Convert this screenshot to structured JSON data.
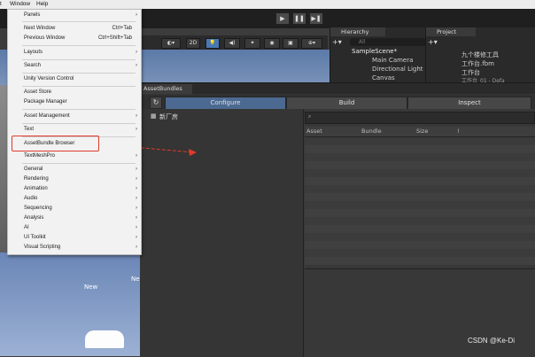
{
  "menubar": {
    "items": [
      "t",
      "Window",
      "Help"
    ]
  },
  "toolbar": {
    "play": "▶",
    "pause": "❚❚",
    "step": "▶❚"
  },
  "scenebar": {
    "mode_2d": "2D"
  },
  "hierarchy": {
    "title": "Hierarchy",
    "search_placeholder": "All",
    "rows": [
      "SampleScene*",
      "Main Camera",
      "Directional Light",
      "Canvas"
    ]
  },
  "project": {
    "title": "Project",
    "rows": [
      "九个楼修工具",
      "工作台.fbm",
      "工作台",
      "工作台_01 - Defa"
    ]
  },
  "asset_bundles": {
    "window_title": "AssetBundles",
    "tabs": [
      "Configure",
      "Build",
      "Inspect"
    ],
    "bundle_item": "新厂房",
    "columns": [
      "Asset",
      "Bundle",
      "Size",
      "!"
    ]
  },
  "menu": {
    "items": [
      {
        "label": "Panels"
      },
      {
        "label": "Next Window",
        "shortcut": "Ctrl+Tab"
      },
      {
        "label": "Previous Window",
        "shortcut": "Ctrl+Shift+Tab"
      },
      {
        "label": "Layouts"
      },
      {
        "label": "Search"
      },
      {
        "label": "Unity Version Control"
      },
      {
        "label": "Asset Store"
      },
      {
        "label": "Package Manager"
      },
      {
        "label": "Asset Management"
      },
      {
        "label": "Text"
      },
      {
        "label": "AssetBundle Browser"
      },
      {
        "label": "TextMeshPro"
      },
      {
        "label": "General"
      },
      {
        "label": "Rendering"
      },
      {
        "label": "Animation"
      },
      {
        "label": "Audio"
      },
      {
        "label": "Sequencing"
      },
      {
        "label": "Analysis"
      },
      {
        "label": "AI"
      },
      {
        "label": "UI Toolkit"
      },
      {
        "label": "Visual Scripting"
      }
    ]
  },
  "scene_labels": {
    "new": "New",
    "ne": "Ne"
  },
  "watermark": "CSDN @Ke-Di",
  "colors": {
    "highlight": "#e03a2a",
    "configure_tab": "#4c6a91"
  }
}
